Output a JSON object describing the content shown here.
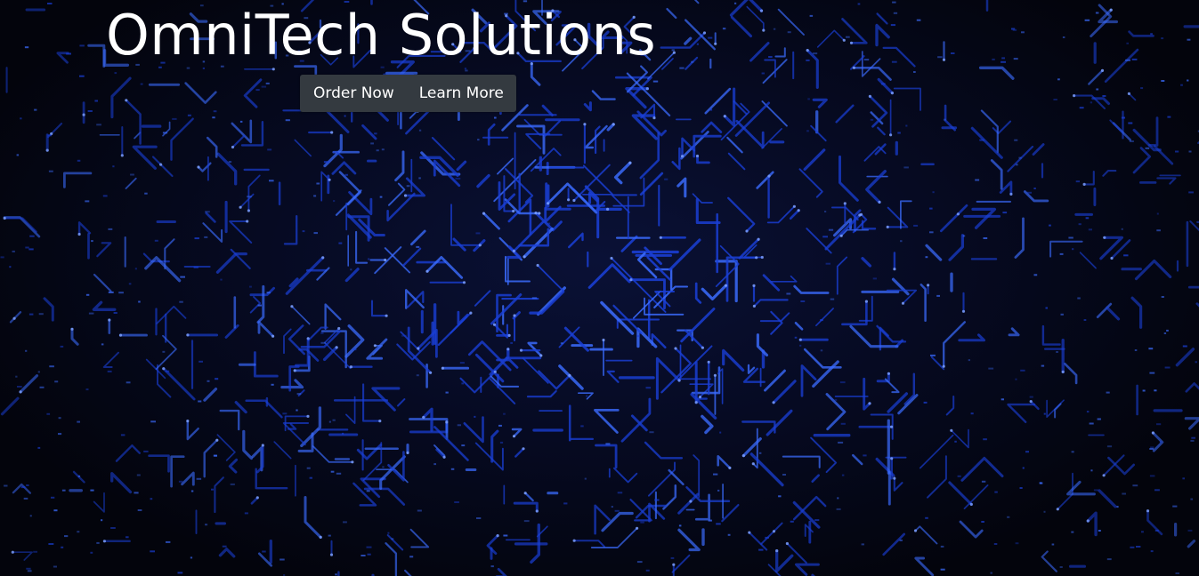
{
  "hero": {
    "title": "OmniTech Solutions",
    "background": "circuit-board-pattern",
    "colors": {
      "background": "#03040c",
      "trace": "#1a3fd6",
      "trace_highlight": "#3b6cff",
      "title_text": "#ffffff",
      "nav_background": "#343a40"
    }
  },
  "nav": {
    "order_label": "Order Now",
    "learn_label": "Learn More"
  }
}
